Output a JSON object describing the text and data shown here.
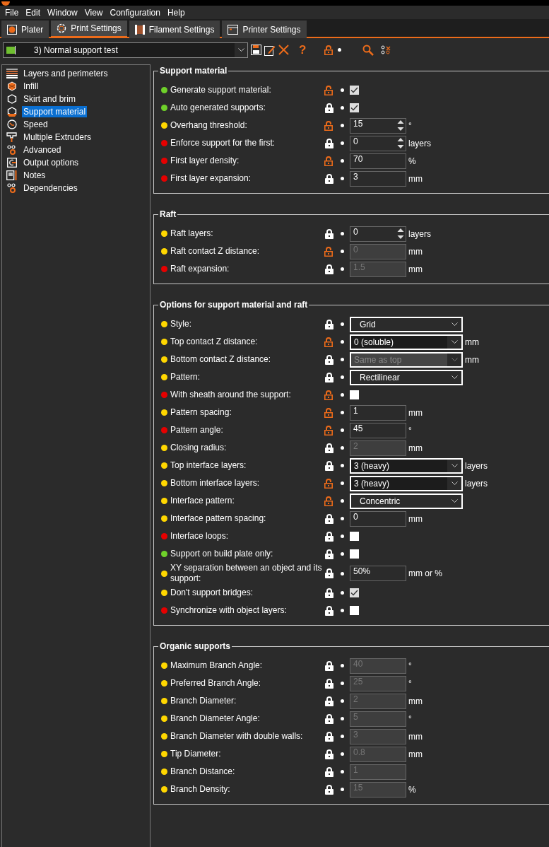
{
  "menu": [
    "File",
    "Edit",
    "Window",
    "View",
    "Configuration",
    "Help"
  ],
  "tabs": [
    {
      "label": "Plater",
      "selected": false
    },
    {
      "label": "Print Settings",
      "selected": true
    },
    {
      "label": "Filament Settings",
      "selected": false
    },
    {
      "label": "Printer Settings",
      "selected": false
    }
  ],
  "preset": {
    "value": "3) Normal support test"
  },
  "toolbar": {
    "help": "?"
  },
  "sidebar": {
    "items": [
      {
        "label": "Layers and perimeters",
        "selected": false
      },
      {
        "label": "Infill",
        "selected": false
      },
      {
        "label": "Skirt and brim",
        "selected": false
      },
      {
        "label": "Support material",
        "selected": true
      },
      {
        "label": "Speed",
        "selected": false
      },
      {
        "label": "Multiple Extruders",
        "selected": false
      },
      {
        "label": "Advanced",
        "selected": false
      },
      {
        "label": "Output options",
        "selected": false
      },
      {
        "label": "Notes",
        "selected": false
      },
      {
        "label": "Dependencies",
        "selected": false
      }
    ]
  },
  "sections": [
    {
      "title": "Support material",
      "options": [
        {
          "label": "Generate support material:",
          "color": "#6fd12a",
          "locked": false,
          "kind": "checkbox",
          "checked": true
        },
        {
          "label": "Auto generated supports:",
          "color": "#6fd12a",
          "locked": true,
          "kind": "checkbox",
          "checked": true
        },
        {
          "label": "Overhang threshold:",
          "color": "#ffd700",
          "locked": false,
          "kind": "spin",
          "value": "15",
          "unit": "°",
          "disabled": false
        },
        {
          "label": "Enforce support for the first:",
          "color": "#e60000",
          "locked": true,
          "kind": "spin",
          "value": "0",
          "unit": "layers",
          "disabled": false
        },
        {
          "label": "First layer density:",
          "color": "#e60000",
          "locked": false,
          "kind": "text",
          "value": "70",
          "unit": "%",
          "disabled": false
        },
        {
          "label": "First layer expansion:",
          "color": "#e60000",
          "locked": true,
          "kind": "text",
          "value": "3",
          "unit": "mm",
          "disabled": false
        }
      ]
    },
    {
      "title": "Raft",
      "options": [
        {
          "label": "Raft layers:",
          "color": "#ffd700",
          "locked": true,
          "kind": "spin",
          "value": "0",
          "unit": "layers",
          "disabled": false
        },
        {
          "label": "Raft contact Z distance:",
          "color": "#ffd700",
          "locked": false,
          "kind": "text",
          "value": "0",
          "unit": "mm",
          "disabled": true
        },
        {
          "label": "Raft expansion:",
          "color": "#e60000",
          "locked": true,
          "kind": "text",
          "value": "1.5",
          "unit": "mm",
          "disabled": true
        }
      ]
    },
    {
      "title": "Options for support material and raft",
      "options": [
        {
          "label": "Style:",
          "color": "#ffd700",
          "locked": true,
          "kind": "choice",
          "value": "Grid",
          "disabled": false
        },
        {
          "label": "Top contact Z distance:",
          "color": "#ffd700",
          "locked": false,
          "kind": "combo",
          "value": "0 (soluble)",
          "unit": "mm",
          "disabled": false
        },
        {
          "label": "Bottom contact Z distance:",
          "color": "#ffd700",
          "locked": true,
          "kind": "combo",
          "value": "Same as top",
          "unit": "mm",
          "disabled": true
        },
        {
          "label": "Pattern:",
          "color": "#ffd700",
          "locked": true,
          "kind": "choice",
          "value": "Rectilinear",
          "disabled": false
        },
        {
          "label": "With sheath around the support:",
          "color": "#e60000",
          "locked": false,
          "kind": "checkbox",
          "checked": false
        },
        {
          "label": "Pattern spacing:",
          "color": "#ffd700",
          "locked": false,
          "kind": "text",
          "value": "1",
          "unit": "mm",
          "disabled": false
        },
        {
          "label": "Pattern angle:",
          "color": "#e60000",
          "locked": false,
          "kind": "text",
          "value": "45",
          "unit": "°",
          "disabled": false
        },
        {
          "label": "Closing radius:",
          "color": "#ffd700",
          "locked": true,
          "kind": "text",
          "value": "2",
          "unit": "mm",
          "disabled": true
        },
        {
          "label": "Top interface layers:",
          "color": "#ffd700",
          "locked": true,
          "kind": "combo",
          "value": "3 (heavy)",
          "unit": "layers",
          "disabled": false
        },
        {
          "label": "Bottom interface layers:",
          "color": "#ffd700",
          "locked": false,
          "kind": "combo",
          "value": "3 (heavy)",
          "unit": "layers",
          "disabled": false
        },
        {
          "label": "Interface pattern:",
          "color": "#ffd700",
          "locked": false,
          "kind": "choice",
          "value": "Concentric",
          "disabled": false
        },
        {
          "label": "Interface pattern spacing:",
          "color": "#ffd700",
          "locked": true,
          "kind": "text",
          "value": "0",
          "unit": "mm",
          "disabled": false
        },
        {
          "label": "Interface loops:",
          "color": "#e60000",
          "locked": true,
          "kind": "checkbox",
          "checked": false
        },
        {
          "label": "Support on build plate only:",
          "color": "#6fd12a",
          "locked": true,
          "kind": "checkbox",
          "checked": false
        },
        {
          "label": "XY separation between an object and its support:",
          "color": "#ffd700",
          "locked": true,
          "kind": "text",
          "value": "50%",
          "unit": "mm or %",
          "disabled": false
        },
        {
          "label": "Don't support bridges:",
          "color": "#ffd700",
          "locked": true,
          "kind": "checkbox",
          "checked": true
        },
        {
          "label": "Synchronize with object layers:",
          "color": "#e60000",
          "locked": true,
          "kind": "checkbox",
          "checked": false
        }
      ]
    },
    {
      "title": "Organic supports",
      "options": [
        {
          "label": "Maximum Branch Angle:",
          "color": "#ffd700",
          "locked": true,
          "kind": "text",
          "value": "40",
          "unit": "°",
          "disabled": true
        },
        {
          "label": "Preferred Branch Angle:",
          "color": "#ffd700",
          "locked": true,
          "kind": "text",
          "value": "25",
          "unit": "°",
          "disabled": true
        },
        {
          "label": "Branch Diameter:",
          "color": "#ffd700",
          "locked": true,
          "kind": "text",
          "value": "2",
          "unit": "mm",
          "disabled": true
        },
        {
          "label": "Branch Diameter Angle:",
          "color": "#ffd700",
          "locked": true,
          "kind": "text",
          "value": "5",
          "unit": "°",
          "disabled": true
        },
        {
          "label": "Branch Diameter with double walls:",
          "color": "#ffd700",
          "locked": true,
          "kind": "text",
          "value": "3",
          "unit": "mm",
          "disabled": true
        },
        {
          "label": "Tip Diameter:",
          "color": "#ffd700",
          "locked": true,
          "kind": "text",
          "value": "0.8",
          "unit": "mm",
          "disabled": true
        },
        {
          "label": "Branch Distance:",
          "color": "#ffd700",
          "locked": true,
          "kind": "text",
          "value": "1",
          "disabled": true
        },
        {
          "label": "Branch Density:",
          "color": "#ffd700",
          "locked": true,
          "kind": "text",
          "value": "15",
          "unit": "%",
          "disabled": true
        }
      ]
    }
  ]
}
